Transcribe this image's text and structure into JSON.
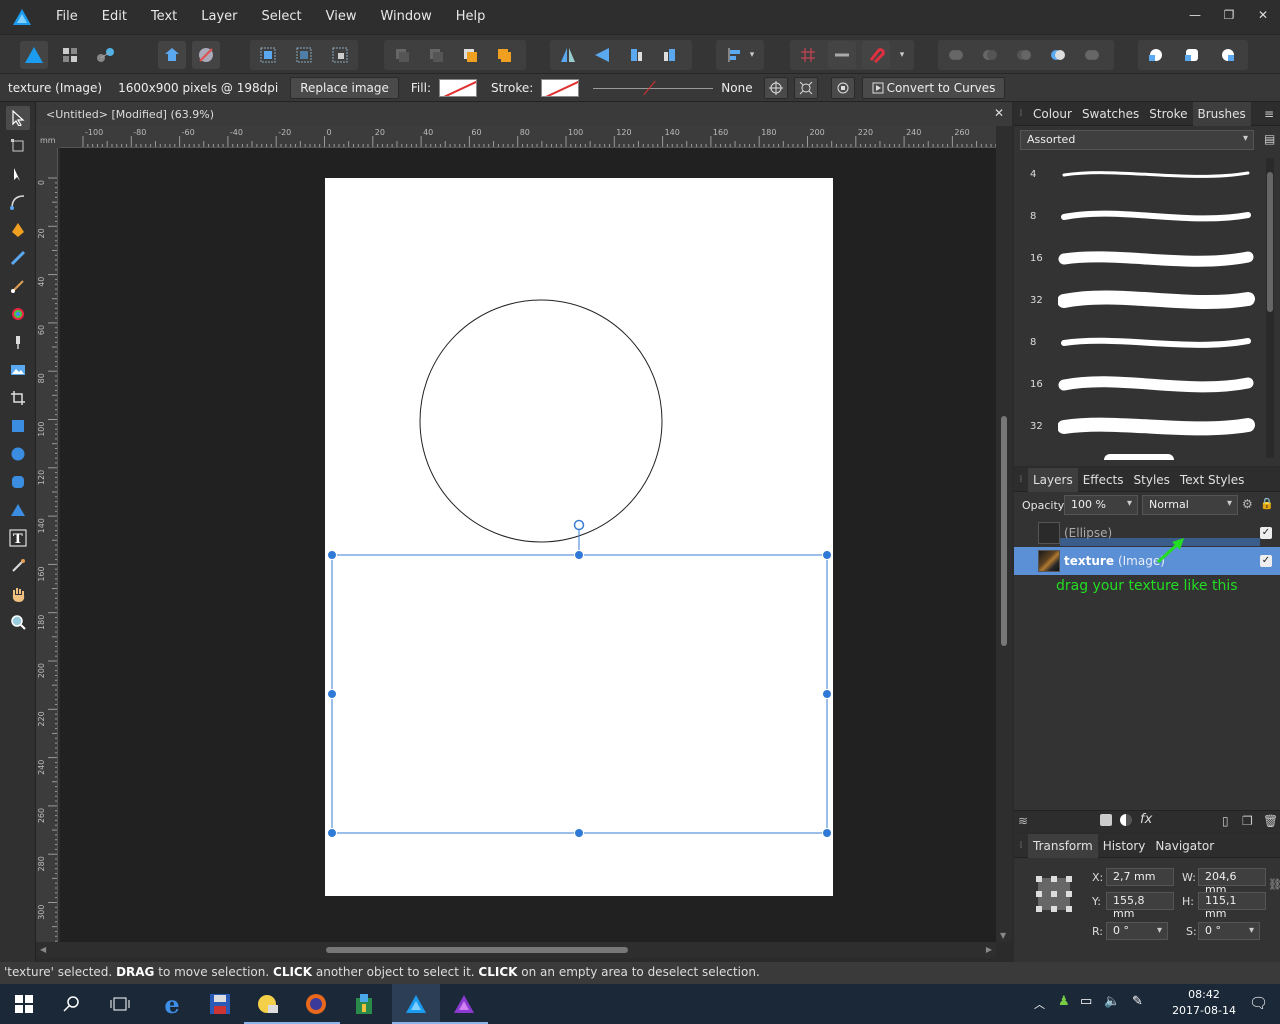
{
  "menu": [
    "File",
    "Edit",
    "Text",
    "Layer",
    "Select",
    "View",
    "Window",
    "Help"
  ],
  "context": {
    "object": "texture (Image)",
    "info": "1600x900 pixels @ 198dpi",
    "replace_label": "Replace image",
    "fill_label": "Fill:",
    "stroke_label": "Stroke:",
    "stroke_value": "None",
    "convert_label": "Convert to Curves"
  },
  "document": {
    "title": "<Untitled> [Modified] (63.9%)",
    "ruler_unit": "mm",
    "ruler_h_ticks": [
      "-100",
      "-80",
      "-60",
      "-40",
      "-20",
      "0",
      "20",
      "40",
      "60",
      "80",
      "100",
      "120",
      "140",
      "160",
      "180",
      "200",
      "220",
      "240",
      "260"
    ],
    "ruler_v_ticks": [
      "0",
      "20",
      "40",
      "60",
      "80",
      "100",
      "120",
      "140",
      "160",
      "180",
      "200",
      "220",
      "240",
      "260",
      "280",
      "300"
    ]
  },
  "brushes_panel": {
    "tabs": [
      "Colour",
      "Swatches",
      "Stroke",
      "Brushes"
    ],
    "category": "Assorted",
    "sizes": [
      "4",
      "8",
      "16",
      "32",
      "8",
      "16",
      "32"
    ]
  },
  "layers_panel": {
    "tabs": [
      "Layers",
      "Effects",
      "Styles",
      "Text Styles"
    ],
    "opacity_label": "Opacity:",
    "opacity_value": "100 %",
    "blend_mode": "Normal",
    "layers": [
      {
        "name": "",
        "type": "(Ellipse)",
        "selected": false
      },
      {
        "name": "texture",
        "type": "(Image)",
        "selected": true
      }
    ],
    "annotation": "drag your texture like this",
    "annotation_color": "#22dd22"
  },
  "transform_panel": {
    "tabs": [
      "Transform",
      "History",
      "Navigator"
    ],
    "x_label": "X:",
    "x": "2,7 mm",
    "y_label": "Y:",
    "y": "155,8 mm",
    "w_label": "W:",
    "w": "204,6 mm",
    "h_label": "H:",
    "h": "115,1 mm",
    "r_label": "R:",
    "r": "0 °",
    "s_label": "S:",
    "s": "0 °"
  },
  "status": {
    "part1": "'texture' selected.",
    "drag": "DRAG",
    "part2": "to move selection.",
    "click1": "CLICK",
    "part3": "another object to select it.",
    "click2": "CLICK",
    "part4": "on an empty area to deselect selection."
  },
  "taskbar": {
    "time": "08:42",
    "date": "2017-08-14"
  },
  "colors": {
    "accent": "#3a7fd5",
    "selected_layer": "#5b8fd6"
  }
}
